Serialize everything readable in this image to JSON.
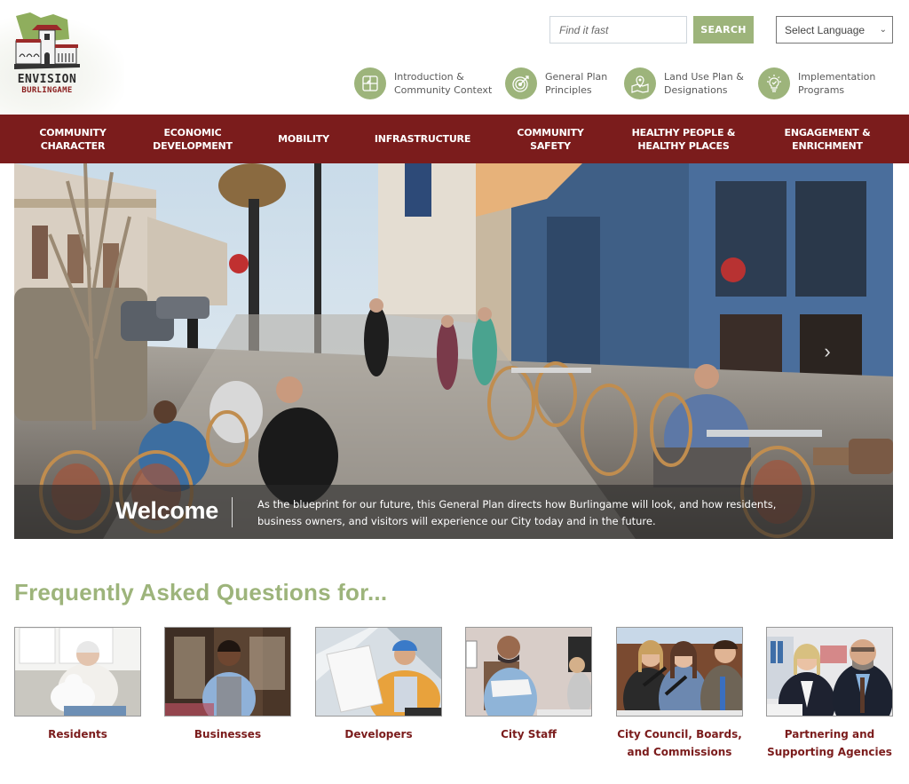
{
  "logo": {
    "line1": "ENVISION",
    "line2": "BURLINGAME"
  },
  "search": {
    "placeholder": "Find it fast",
    "value": "",
    "button_label": "SEARCH"
  },
  "language": {
    "selected": "Select Language",
    "icon": "chevron-down-icon"
  },
  "quicklinks": [
    {
      "line1": "Introduction &",
      "line2": "Community Context",
      "icon": "puzzle-icon"
    },
    {
      "line1": "General Plan",
      "line2": "Principles",
      "icon": "target-icon"
    },
    {
      "line1": "Land Use Plan &",
      "line2": "Designations",
      "icon": "map-pin-icon"
    },
    {
      "line1": "Implementation",
      "line2": "Programs",
      "icon": "lightbulb-icon"
    }
  ],
  "nav": [
    {
      "line1": "COMMUNITY",
      "line2": "CHARACTER"
    },
    {
      "line1": "ECONOMIC",
      "line2": "DEVELOPMENT"
    },
    {
      "line1": "MOBILITY",
      "line2": ""
    },
    {
      "line1": "INFRASTRUCTURE",
      "line2": ""
    },
    {
      "line1": "COMMUNITY",
      "line2": "SAFETY"
    },
    {
      "line1": "HEALTHY PEOPLE &",
      "line2": "HEALTHY PLACES"
    },
    {
      "line1": "ENGAGEMENT &",
      "line2": "ENRICHMENT"
    }
  ],
  "hero": {
    "title": "Welcome",
    "text": "As the blueprint for our future, this General Plan directs how Burlingame will look, and how residents, business owners, and visitors will experience our City today and in the future.",
    "next_icon": "chevron-right-icon"
  },
  "faq": {
    "title": "Frequently Asked Questions for...",
    "cards": [
      {
        "line1": "Residents",
        "line2": "",
        "image": "resident-with-dog-photo"
      },
      {
        "line1": "Businesses",
        "line2": "",
        "image": "shop-owner-photo"
      },
      {
        "line1": "Developers",
        "line2": "",
        "image": "developer-hardhat-photo"
      },
      {
        "line1": "City Staff",
        "line2": "",
        "image": "city-staff-photo"
      },
      {
        "line1": "City Council, Boards,",
        "line2": "and Commissions",
        "image": "council-meeting-photo"
      },
      {
        "line1": "Partnering and",
        "line2": "Supporting Agencies",
        "image": "agency-partners-photo"
      }
    ]
  },
  "colors": {
    "brand_red": "#7b1c1c",
    "accent_green": "#9db47b"
  }
}
